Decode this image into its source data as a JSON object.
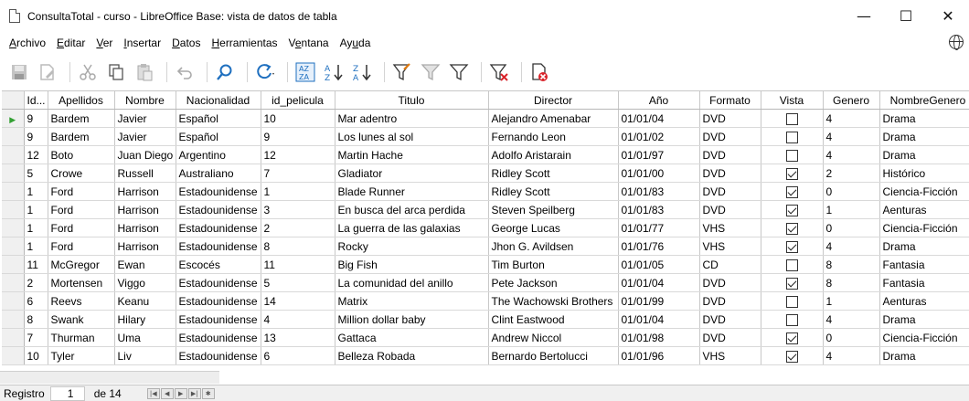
{
  "window": {
    "title": "ConsultaTotal - curso - LibreOffice Base: vista de datos de tabla",
    "minimize": "—",
    "maximize": "☐",
    "close": "✕"
  },
  "menu": [
    {
      "pre": "",
      "u": "A",
      "post": "rchivo"
    },
    {
      "pre": "",
      "u": "E",
      "post": "ditar"
    },
    {
      "pre": "",
      "u": "V",
      "post": "er"
    },
    {
      "pre": "",
      "u": "I",
      "post": "nsertar"
    },
    {
      "pre": "",
      "u": "D",
      "post": "atos"
    },
    {
      "pre": "",
      "u": "H",
      "post": "erramientas"
    },
    {
      "pre": "V",
      "u": "e",
      "post": "ntana"
    },
    {
      "pre": "Ay",
      "u": "u",
      "post": "da"
    }
  ],
  "toolbar_icons": [
    "save-icon",
    "edit-icon",
    "cut-icon",
    "copy-icon",
    "paste-icon",
    "undo-icon",
    "find-icon",
    "refresh-icon",
    "sort-icon",
    "sort-ascending-icon",
    "sort-descending-icon",
    "autofilter-icon",
    "standard-filter-icon",
    "filter-icon",
    "remove-filter-icon",
    "delete-record-icon"
  ],
  "columns": [
    "Id...",
    "Apellidos",
    "Nombre",
    "Nacionalidad",
    "id_pelicula",
    "Titulo",
    "Director",
    "Año",
    "Formato",
    "Vista",
    "Genero",
    "NombreGenero"
  ],
  "rows": [
    {
      "id": "9",
      "apellidos": "Bardem",
      "nombre": "Javier",
      "nacionalidad": "Español",
      "id_pelicula": "10",
      "titulo": "Mar adentro",
      "director": "Alejandro Amenabar",
      "anio": "01/01/04",
      "formato": "DVD",
      "vista": false,
      "genero": "4",
      "nombre_genero": "Drama"
    },
    {
      "id": "9",
      "apellidos": "Bardem",
      "nombre": "Javier",
      "nacionalidad": "Español",
      "id_pelicula": "9",
      "titulo": "Los lunes al sol",
      "director": "Fernando Leon",
      "anio": "01/01/02",
      "formato": "DVD",
      "vista": false,
      "genero": "4",
      "nombre_genero": "Drama"
    },
    {
      "id": "12",
      "apellidos": "Boto",
      "nombre": "Juan Diego",
      "nacionalidad": "Argentino",
      "id_pelicula": "12",
      "titulo": "Martin Hache",
      "director": "Adolfo Aristarain",
      "anio": "01/01/97",
      "formato": "DVD",
      "vista": false,
      "genero": "4",
      "nombre_genero": "Drama"
    },
    {
      "id": "5",
      "apellidos": "Crowe",
      "nombre": "Russell",
      "nacionalidad": "Australiano",
      "id_pelicula": "7",
      "titulo": "Gladiator",
      "director": "Ridley Scott",
      "anio": "01/01/00",
      "formato": "DVD",
      "vista": true,
      "genero": "2",
      "nombre_genero": "Histórico"
    },
    {
      "id": "1",
      "apellidos": "Ford",
      "nombre": "Harrison",
      "nacionalidad": "Estadounidense",
      "id_pelicula": "1",
      "titulo": "Blade Runner",
      "director": "Ridley Scott",
      "anio": "01/01/83",
      "formato": "DVD",
      "vista": true,
      "genero": "0",
      "nombre_genero": "Ciencia-Ficción"
    },
    {
      "id": "1",
      "apellidos": "Ford",
      "nombre": "Harrison",
      "nacionalidad": "Estadounidense",
      "id_pelicula": "3",
      "titulo": "En busca del arca perdida",
      "director": "Steven Speilberg",
      "anio": "01/01/83",
      "formato": "DVD",
      "vista": true,
      "genero": "1",
      "nombre_genero": "Aenturas"
    },
    {
      "id": "1",
      "apellidos": "Ford",
      "nombre": "Harrison",
      "nacionalidad": "Estadounidense",
      "id_pelicula": "2",
      "titulo": "La guerra de las galaxias",
      "director": "George Lucas",
      "anio": "01/01/77",
      "formato": "VHS",
      "vista": true,
      "genero": "0",
      "nombre_genero": "Ciencia-Ficción"
    },
    {
      "id": "1",
      "apellidos": "Ford",
      "nombre": "Harrison",
      "nacionalidad": "Estadounidense",
      "id_pelicula": "8",
      "titulo": "Rocky",
      "director": "Jhon G. Avildsen",
      "anio": "01/01/76",
      "formato": "VHS",
      "vista": true,
      "genero": "4",
      "nombre_genero": "Drama"
    },
    {
      "id": "11",
      "apellidos": "McGregor",
      "nombre": "Ewan",
      "nacionalidad": "Escocés",
      "id_pelicula": "11",
      "titulo": "Big Fish",
      "director": "Tim Burton",
      "anio": "01/01/05",
      "formato": "CD",
      "vista": false,
      "genero": "8",
      "nombre_genero": "Fantasia"
    },
    {
      "id": "2",
      "apellidos": "Mortensen",
      "nombre": "Viggo",
      "nacionalidad": "Estadounidense",
      "id_pelicula": "5",
      "titulo": "La comunidad del anillo",
      "director": "Pete Jackson",
      "anio": "01/01/04",
      "formato": "DVD",
      "vista": true,
      "genero": "8",
      "nombre_genero": "Fantasia"
    },
    {
      "id": "6",
      "apellidos": "Reevs",
      "nombre": "Keanu",
      "nacionalidad": "Estadounidense",
      "id_pelicula": "14",
      "titulo": "Matrix",
      "director": "The Wachowski Brothers",
      "anio": "01/01/99",
      "formato": "DVD",
      "vista": false,
      "genero": "1",
      "nombre_genero": "Aenturas"
    },
    {
      "id": "8",
      "apellidos": "Swank",
      "nombre": "Hilary",
      "nacionalidad": "Estadounidense",
      "id_pelicula": "4",
      "titulo": "Million dollar baby",
      "director": "Clint Eastwood",
      "anio": "01/01/04",
      "formato": "DVD",
      "vista": false,
      "genero": "4",
      "nombre_genero": "Drama"
    },
    {
      "id": "7",
      "apellidos": "Thurman",
      "nombre": "Uma",
      "nacionalidad": "Estadounidense",
      "id_pelicula": "13",
      "titulo": "Gattaca",
      "director": "Andrew Niccol",
      "anio": "01/01/98",
      "formato": "DVD",
      "vista": true,
      "genero": "0",
      "nombre_genero": "Ciencia-Ficción"
    },
    {
      "id": "10",
      "apellidos": "Tyler",
      "nombre": "Liv",
      "nacionalidad": "Estadounidense",
      "id_pelicula": "6",
      "titulo": "Belleza Robada",
      "director": "Bernardo Bertolucci",
      "anio": "01/01/96",
      "formato": "VHS",
      "vista": true,
      "genero": "4",
      "nombre_genero": "Drama"
    }
  ],
  "navigation": {
    "label": "Registro",
    "current": "1",
    "of_total": "de 14"
  }
}
